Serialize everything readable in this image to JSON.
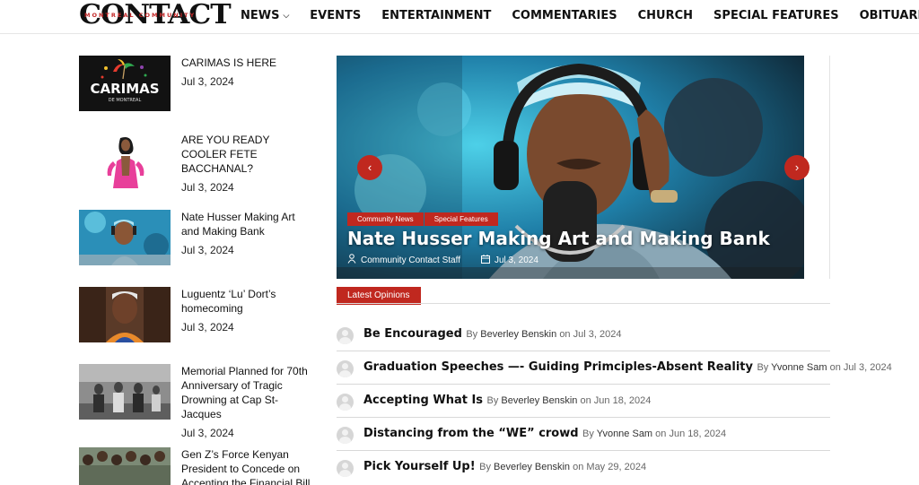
{
  "header": {
    "logo_text": "CONTACT",
    "logo_subtext": "MONTREAL COMMUNITY",
    "nav": [
      {
        "label": "NEWS",
        "dropdown": true
      },
      {
        "label": "EVENTS"
      },
      {
        "label": "ENTERTAINMENT"
      },
      {
        "label": "COMMENTARIES"
      },
      {
        "label": "CHURCH"
      },
      {
        "label": "SPECIAL FEATURES"
      },
      {
        "label": "OBITUARIES"
      }
    ]
  },
  "sidebar_articles": [
    {
      "title": "CARIMAS IS HERE",
      "date": "Jul 3, 2024",
      "thumb_text": "CARIMAS",
      "thumb_subtext": "DE MONTREAL"
    },
    {
      "title": "ARE YOU READY COOLER FETE BACCHANAL?",
      "date": "Jul 3, 2024"
    },
    {
      "title": "Nate Husser Making Art and Making Bank",
      "date": "Jul 3, 2024"
    },
    {
      "title": "Luguentz ‘Lu’ Dort’s homecoming",
      "date": "Jul 3, 2024"
    },
    {
      "title": "Memorial Planned for 70th Anniversary of Tragic Drowning at Cap St-Jacques",
      "date": "Jul 3, 2024"
    },
    {
      "title": "Gen Z’s Force Kenyan President to Concede on Accenting the Financial Bill",
      "date": ""
    }
  ],
  "hero": {
    "tags": [
      "Community News",
      "Special Features"
    ],
    "title": "Nate Husser Making Art and Making Bank",
    "author": "Community Contact Staff",
    "date": "Jul 3, 2024",
    "prev_symbol": "‹",
    "next_symbol": "›"
  },
  "latest_opinions": {
    "label": "Latest Opinions",
    "by": "By",
    "on": "on",
    "items": [
      {
        "title": "Be Encouraged",
        "author": "Beverley Benskin",
        "date": "Jul 3, 2024"
      },
      {
        "title": "Graduation Speeches —- Guiding Primciples-Absent Reality",
        "author": "Yvonne Sam",
        "date": "Jul 3, 2024"
      },
      {
        "title": "Accepting What Is",
        "author": "Beverley Benskin",
        "date": "Jun 18, 2024"
      },
      {
        "title": "Distancing from the “WE” crowd",
        "author": "Yvonne Sam",
        "date": "Jun 18, 2024"
      },
      {
        "title": "Pick Yourself Up!",
        "author": "Beverley Benskin",
        "date": "May 29, 2024"
      }
    ]
  },
  "colors": {
    "accent": "#c0281f",
    "logo_red": "#c42a2a"
  }
}
